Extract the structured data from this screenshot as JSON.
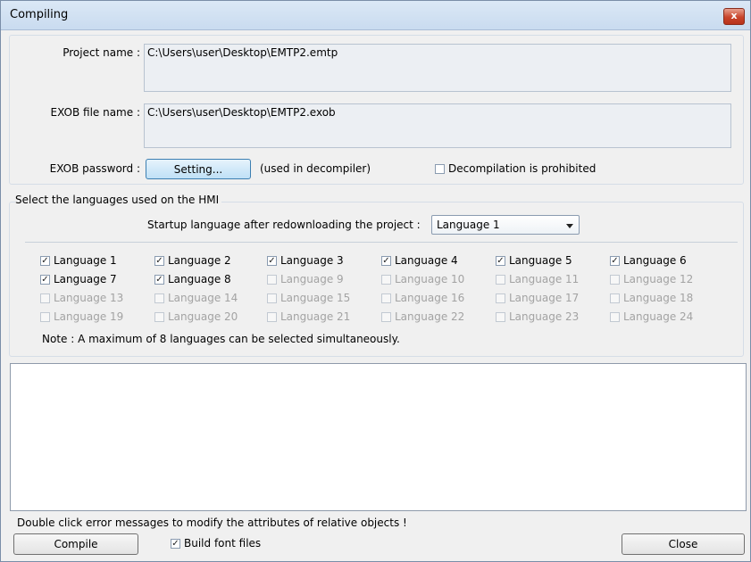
{
  "window": {
    "title": "Compiling",
    "close_glyph": "x"
  },
  "project": {
    "name_label": "Project name :",
    "name_value": "C:\\Users\\user\\Desktop\\EMTP2.emtp",
    "exob_label": "EXOB file name :",
    "exob_value": "C:\\Users\\user\\Desktop\\EMTP2.exob",
    "password_label": "EXOB password :",
    "setting_button": "Setting...",
    "used_in_decompiler": "(used in decompiler)",
    "decompilation_prohibited": {
      "label": "Decompilation is prohibited",
      "checked": false
    }
  },
  "languages": {
    "group_title": "Select the languages used on the HMI",
    "startup_label": "Startup language after redownloading the project :",
    "startup_selected": "Language 1",
    "items": [
      {
        "label": "Language 1",
        "checked": true,
        "enabled": true
      },
      {
        "label": "Language 2",
        "checked": true,
        "enabled": true
      },
      {
        "label": "Language 3",
        "checked": true,
        "enabled": true
      },
      {
        "label": "Language 4",
        "checked": true,
        "enabled": true
      },
      {
        "label": "Language 5",
        "checked": true,
        "enabled": true
      },
      {
        "label": "Language 6",
        "checked": true,
        "enabled": true
      },
      {
        "label": "Language 7",
        "checked": true,
        "enabled": true
      },
      {
        "label": "Language 8",
        "checked": true,
        "enabled": true
      },
      {
        "label": "Language 9",
        "checked": false,
        "enabled": false
      },
      {
        "label": "Language 10",
        "checked": false,
        "enabled": false
      },
      {
        "label": "Language 11",
        "checked": false,
        "enabled": false
      },
      {
        "label": "Language 12",
        "checked": false,
        "enabled": false
      },
      {
        "label": "Language 13",
        "checked": false,
        "enabled": false
      },
      {
        "label": "Language 14",
        "checked": false,
        "enabled": false
      },
      {
        "label": "Language 15",
        "checked": false,
        "enabled": false
      },
      {
        "label": "Language 16",
        "checked": false,
        "enabled": false
      },
      {
        "label": "Language 17",
        "checked": false,
        "enabled": false
      },
      {
        "label": "Language 18",
        "checked": false,
        "enabled": false
      },
      {
        "label": "Language 19",
        "checked": false,
        "enabled": false
      },
      {
        "label": "Language 20",
        "checked": false,
        "enabled": false
      },
      {
        "label": "Language 21",
        "checked": false,
        "enabled": false
      },
      {
        "label": "Language 22",
        "checked": false,
        "enabled": false
      },
      {
        "label": "Language 23",
        "checked": false,
        "enabled": false
      },
      {
        "label": "Language 24",
        "checked": false,
        "enabled": false
      }
    ],
    "note": "Note : A maximum of 8 languages can be selected simultaneously."
  },
  "messages": {
    "hint": "Double click error messages to modify the attributes of relative objects !"
  },
  "footer": {
    "compile_button": "Compile",
    "build_font_files": {
      "label": "Build font files",
      "checked": true
    },
    "close_button": "Close"
  }
}
